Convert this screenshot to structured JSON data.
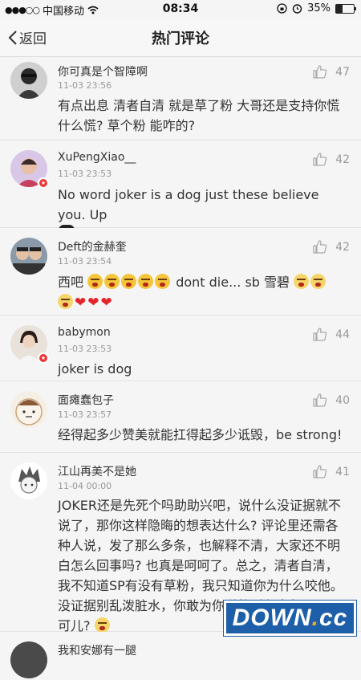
{
  "status": {
    "carrier": "中国移动",
    "time": "08:34",
    "battery": "35%"
  },
  "nav": {
    "back_label": "返回",
    "title": "热门评论"
  },
  "comments": [
    {
      "user": "你可真是个智障啊",
      "time": "11-03 23:56",
      "likes": "47",
      "text": "有点出息 清者自清 就是草了粉 大哥还是支持你慌什么慌? 草个粉 能咋的?"
    },
    {
      "user": "XuPengXiao__",
      "time": "11-03 23:53",
      "likes": "42",
      "text": "No word joker is a dog just these believe you. Up"
    },
    {
      "user": "Deft的金赫奎",
      "time": "11-03 23:54",
      "likes": "42",
      "text_a": "西吧",
      "text_b": "dont die... sb 雪碧"
    },
    {
      "user": "babymon",
      "time": "11-03 23:53",
      "likes": "44",
      "text": "joker is dog"
    },
    {
      "user": "面瘫蠢包子",
      "time": "11-03 23:57",
      "likes": "40",
      "text": "经得起多少赞美就能扛得起多少诋毁，be strong!"
    },
    {
      "user": "江山再美不是她",
      "time": "11-04 00:00",
      "likes": "41",
      "text": "JOKER还是先死个吗助助兴吧，说什么没证据就不说了，那你这样隐晦的想表达什么? 评论里还需各种人说，发了那么多条，也解释不清，大家还不明白怎么回事吗? 也真是呵呵了。总之，清者自清，我不知道SP有没有草粉，我只知道你为什么咬他。没证据别乱泼脏水，你敢为你说的话负责任吗? 周可儿?"
    },
    {
      "user": "我和安娜有一腿"
    }
  ],
  "watermark": {
    "main": "DOWN",
    "dot": ".",
    "tld": "cc"
  }
}
